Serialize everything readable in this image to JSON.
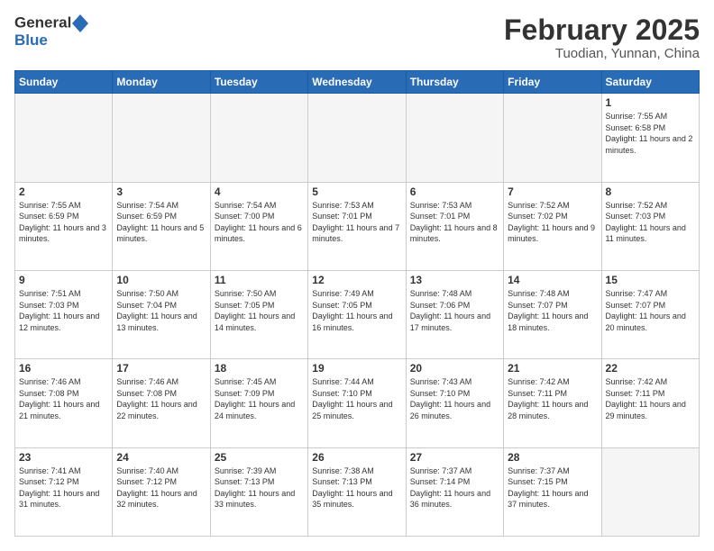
{
  "header": {
    "logo_general": "General",
    "logo_blue": "Blue",
    "month_title": "February 2025",
    "location": "Tuodian, Yunnan, China"
  },
  "days_of_week": [
    "Sunday",
    "Monday",
    "Tuesday",
    "Wednesday",
    "Thursday",
    "Friday",
    "Saturday"
  ],
  "weeks": [
    [
      {
        "day": "",
        "empty": true
      },
      {
        "day": "",
        "empty": true
      },
      {
        "day": "",
        "empty": true
      },
      {
        "day": "",
        "empty": true
      },
      {
        "day": "",
        "empty": true
      },
      {
        "day": "",
        "empty": true
      },
      {
        "day": "1",
        "sunrise": "7:55 AM",
        "sunset": "6:58 PM",
        "daylight": "11 hours and 2 minutes."
      }
    ],
    [
      {
        "day": "2",
        "sunrise": "7:55 AM",
        "sunset": "6:59 PM",
        "daylight": "11 hours and 3 minutes."
      },
      {
        "day": "3",
        "sunrise": "7:54 AM",
        "sunset": "6:59 PM",
        "daylight": "11 hours and 5 minutes."
      },
      {
        "day": "4",
        "sunrise": "7:54 AM",
        "sunset": "7:00 PM",
        "daylight": "11 hours and 6 minutes."
      },
      {
        "day": "5",
        "sunrise": "7:53 AM",
        "sunset": "7:01 PM",
        "daylight": "11 hours and 7 minutes."
      },
      {
        "day": "6",
        "sunrise": "7:53 AM",
        "sunset": "7:01 PM",
        "daylight": "11 hours and 8 minutes."
      },
      {
        "day": "7",
        "sunrise": "7:52 AM",
        "sunset": "7:02 PM",
        "daylight": "11 hours and 9 minutes."
      },
      {
        "day": "8",
        "sunrise": "7:52 AM",
        "sunset": "7:03 PM",
        "daylight": "11 hours and 11 minutes."
      }
    ],
    [
      {
        "day": "9",
        "sunrise": "7:51 AM",
        "sunset": "7:03 PM",
        "daylight": "11 hours and 12 minutes."
      },
      {
        "day": "10",
        "sunrise": "7:50 AM",
        "sunset": "7:04 PM",
        "daylight": "11 hours and 13 minutes."
      },
      {
        "day": "11",
        "sunrise": "7:50 AM",
        "sunset": "7:05 PM",
        "daylight": "11 hours and 14 minutes."
      },
      {
        "day": "12",
        "sunrise": "7:49 AM",
        "sunset": "7:05 PM",
        "daylight": "11 hours and 16 minutes."
      },
      {
        "day": "13",
        "sunrise": "7:48 AM",
        "sunset": "7:06 PM",
        "daylight": "11 hours and 17 minutes."
      },
      {
        "day": "14",
        "sunrise": "7:48 AM",
        "sunset": "7:07 PM",
        "daylight": "11 hours and 18 minutes."
      },
      {
        "day": "15",
        "sunrise": "7:47 AM",
        "sunset": "7:07 PM",
        "daylight": "11 hours and 20 minutes."
      }
    ],
    [
      {
        "day": "16",
        "sunrise": "7:46 AM",
        "sunset": "7:08 PM",
        "daylight": "11 hours and 21 minutes."
      },
      {
        "day": "17",
        "sunrise": "7:46 AM",
        "sunset": "7:08 PM",
        "daylight": "11 hours and 22 minutes."
      },
      {
        "day": "18",
        "sunrise": "7:45 AM",
        "sunset": "7:09 PM",
        "daylight": "11 hours and 24 minutes."
      },
      {
        "day": "19",
        "sunrise": "7:44 AM",
        "sunset": "7:10 PM",
        "daylight": "11 hours and 25 minutes."
      },
      {
        "day": "20",
        "sunrise": "7:43 AM",
        "sunset": "7:10 PM",
        "daylight": "11 hours and 26 minutes."
      },
      {
        "day": "21",
        "sunrise": "7:42 AM",
        "sunset": "7:11 PM",
        "daylight": "11 hours and 28 minutes."
      },
      {
        "day": "22",
        "sunrise": "7:42 AM",
        "sunset": "7:11 PM",
        "daylight": "11 hours and 29 minutes."
      }
    ],
    [
      {
        "day": "23",
        "sunrise": "7:41 AM",
        "sunset": "7:12 PM",
        "daylight": "11 hours and 31 minutes."
      },
      {
        "day": "24",
        "sunrise": "7:40 AM",
        "sunset": "7:12 PM",
        "daylight": "11 hours and 32 minutes."
      },
      {
        "day": "25",
        "sunrise": "7:39 AM",
        "sunset": "7:13 PM",
        "daylight": "11 hours and 33 minutes."
      },
      {
        "day": "26",
        "sunrise": "7:38 AM",
        "sunset": "7:13 PM",
        "daylight": "11 hours and 35 minutes."
      },
      {
        "day": "27",
        "sunrise": "7:37 AM",
        "sunset": "7:14 PM",
        "daylight": "11 hours and 36 minutes."
      },
      {
        "day": "28",
        "sunrise": "7:37 AM",
        "sunset": "7:15 PM",
        "daylight": "11 hours and 37 minutes."
      },
      {
        "day": "",
        "empty": true
      }
    ]
  ]
}
